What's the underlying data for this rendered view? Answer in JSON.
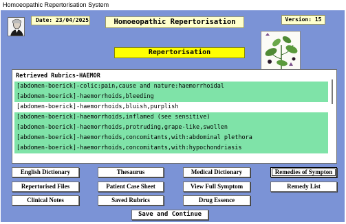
{
  "window": {
    "title": "Homoeopathic Repertorisation System"
  },
  "header": {
    "date_label": "Date: 23/04/2025",
    "app_title": "Homoeopathic Repertorisation",
    "version_label": "Version: 15"
  },
  "section_title": "Repertorisation",
  "list": {
    "header": "Retrieved Rubrics-HAEMOR",
    "rows": [
      {
        "text": "[abdomen-boerick]-colic:pain,cause and nature:haemorrhoidal",
        "highlighted": true
      },
      {
        "text": "[abdomen-boerick]-haemorrhoids,bleeding",
        "highlighted": true
      },
      {
        "text": "[abdomen-boerick]-haemorrhoids,bluish,purplish",
        "highlighted": false
      },
      {
        "text": "[abdomen-boerick]-haemorrhoids,inflamed (see sensitive)",
        "highlighted": true
      },
      {
        "text": "[abdomen-boerick]-haemorrhoids,protruding,grape-like,swollen",
        "highlighted": true
      },
      {
        "text": "[abdomen-boerick]-haemorrhoids,concomitants,with:abdominal plethora",
        "highlighted": true
      },
      {
        "text": "[abdomen-boerick]-haemorrhoids,concomitants,with:hypochondriasis",
        "highlighted": true
      }
    ]
  },
  "buttons": {
    "english_dictionary": "English Dictionary",
    "thesaurus": "Thesaurus",
    "medical_dictionary": "Medical Dictionary",
    "remedies_of_symptom": "Remedies of Sympton",
    "repertorised_files": "Repertorised Files",
    "patient_case_sheet": "Patient Case Sheet",
    "view_full_symptom": "View Full Symptom",
    "remedy_list": "Remedy List",
    "clinical_notes": "Clinical Notes",
    "saved_rubrics": "Saved Rubrics",
    "drug_essence": "Drug Essence",
    "save_and_continue": "Save and Continue"
  },
  "colors": {
    "background": "#7b93d6",
    "row_highlight": "#7fe3a8",
    "info_box": "#ffffcc",
    "section_title_bg": "#ffff00"
  }
}
